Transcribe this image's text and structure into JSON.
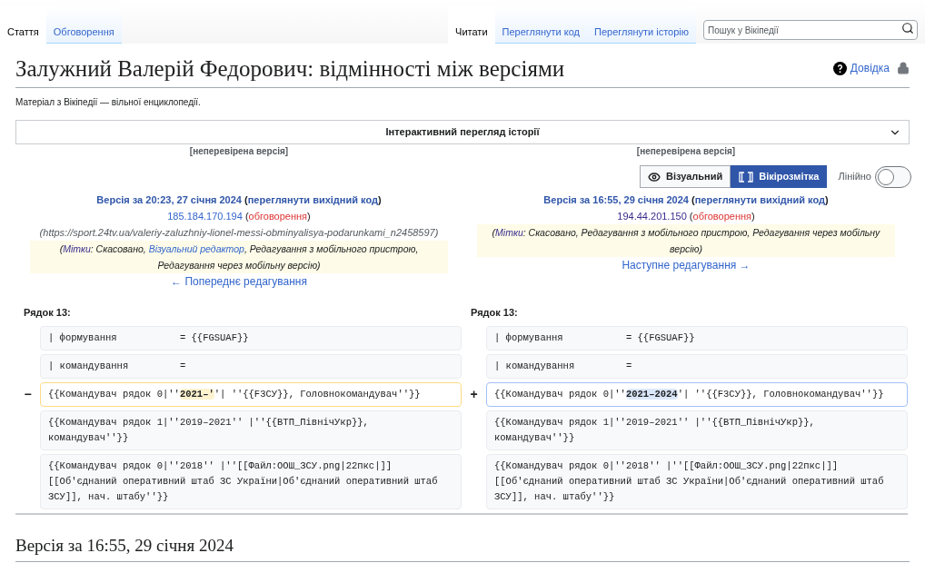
{
  "left_tabs": [
    {
      "label": "Стаття",
      "selected": true
    },
    {
      "label": "Обговорення",
      "selected": false
    }
  ],
  "right_tabs": [
    {
      "label": "Читати",
      "selected": true
    },
    {
      "label": "Переглянути код",
      "selected": false
    },
    {
      "label": "Переглянути історію",
      "selected": false
    }
  ],
  "search": {
    "placeholder": "Пошук у Вікіпедії"
  },
  "title": "Залужний Валерій Федорович: відмінності між версіями",
  "help": "Довідка",
  "subtitle": "Матеріал з Вікіпедії — вільної енциклопедії.",
  "history_panel": {
    "label": "Інтерактивний перегляд історії",
    "expanded": false
  },
  "view_modes": [
    {
      "label": "Візуальний",
      "selected": false
    },
    {
      "label": "Вікірозмітка",
      "selected": true
    }
  ],
  "linear": {
    "label": "Лінійно",
    "on": false
  },
  "revisions": [
    {
      "status": "[неперевірена версія]",
      "heading": "Версія за 20:23, 27 січня 2024",
      "parens": [
        "(",
        ")",
        "(",
        ")"
      ],
      "source_link": "переглянути вихідний код",
      "user": "185.184.170.194",
      "talk": "обговорення",
      "summary": "(https://sport.24tv.ua/valeriy-zaluzhniy-lionel-messi-obminyalisya-podarunkami_n2458597)",
      "tags": [
        {
          "text": "(",
          "kind": "plain"
        },
        {
          "text": "Мітки",
          "kind": "label"
        },
        {
          "text": ": Скасовано, ",
          "kind": "plain"
        },
        {
          "text": "Візуальний редактор",
          "kind": "link"
        },
        {
          "text": ", Редагування з мобільного пристрою, Редагування через мобільну версію)",
          "kind": "plain"
        }
      ],
      "nav": "← Попереднє редагування"
    },
    {
      "status": "[неперевірена версія]",
      "heading": "Версія за 16:55, 29 січня 2024",
      "parens": [
        "(",
        ")",
        "(",
        ")"
      ],
      "source_link": "переглянути вихідний код",
      "user": "194.44.201.150",
      "talk": "обговорення",
      "tags": [
        {
          "text": "(",
          "kind": "plain"
        },
        {
          "text": "Мітки",
          "kind": "label"
        },
        {
          "text": ": Скасовано, Редагування з мобільного пристрою, Редагування через мобільну версію)",
          "kind": "plain"
        }
      ],
      "nav": "Наступне редагування →"
    }
  ],
  "diff": {
    "line_labels": [
      "Рядок 13:",
      "Рядок 13:"
    ],
    "rows": [
      {
        "kind": "context",
        "left": "| формування           = {{FGSUAF}}",
        "right": "| формування           = {{FGSUAF}}"
      },
      {
        "kind": "context",
        "left": "| командування         =",
        "right": "| командування         ="
      },
      {
        "kind": "change",
        "left_marker": "−",
        "right_marker": "+",
        "left": [
          {
            "text": "{{Командувач рядок 0|''",
            "highlight": false
          },
          {
            "text": "2021–'",
            "highlight": true
          },
          {
            "text": "'| ''{{F3СУ}}, Головнокомандувач''}}",
            "highlight": false
          }
        ],
        "right": [
          {
            "text": "{{Командувач рядок 0|''",
            "highlight": false
          },
          {
            "text": "2021–2024",
            "highlight": true
          },
          {
            "text": "'| ''{{F3СУ}}, Головнокомандувач''}}",
            "highlight": false
          }
        ]
      },
      {
        "kind": "context",
        "left": "{{Командувач рядок 1|''2019–2021'' |''{{ВТП_ПівнічУкр}}, командувач''}}",
        "right": "{{Командувач рядок 1|''2019–2021'' |''{{ВТП_ПівнічУкр}}, командувач''}}"
      },
      {
        "kind": "context",
        "left": "{{Командувач рядок 0|''2018'' |''[[Файл:ООШ_ЗСУ.png|22пкс|]] [[Об'єднаний оперативний штаб ЗС України|Об'єднаний оперативний штаб ЗСУ]], нач. штабу''}}",
        "right": "{{Командувач рядок 0|''2018'' |''[[Файл:ООШ_ЗСУ.png|22пкс|]] [[Об'єднаний оперативний штаб ЗС України|Об'єднаний оперативний штаб ЗСУ]], нач. штабу''}}"
      }
    ]
  },
  "section_heading": "Версія за 16:55, 29 січня 2024"
}
